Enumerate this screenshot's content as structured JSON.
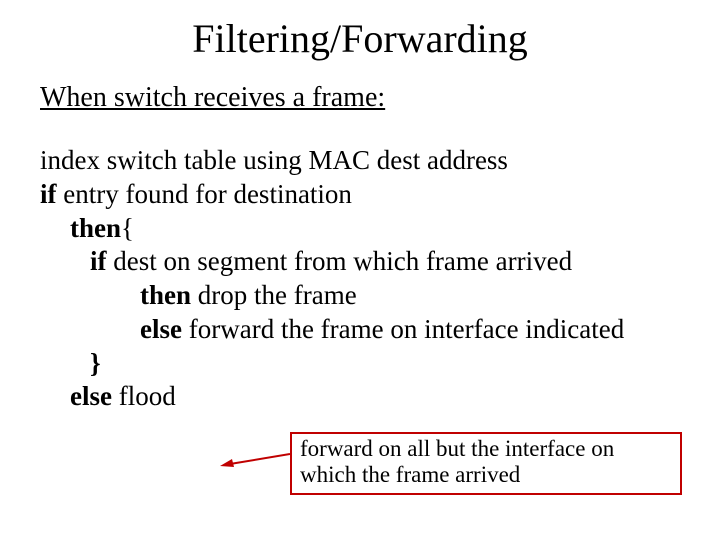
{
  "title": "Filtering/Forwarding",
  "subhead": "When switch receives a frame:",
  "l1": "index switch table using MAC dest address",
  "l2a": "if",
  "l2b": " entry found for destination",
  "l3a": "then",
  "l3b": "{",
  "l4a": "if",
  "l4b": " dest on segment from which frame arrived",
  "l5a": "then",
  "l5b": " drop the frame",
  "l6a": "else",
  "l6b": " forward the frame on interface indicated",
  "l7": "}",
  "l8a": "else",
  "l8b": " flood",
  "callout": "forward on all but the interface on which the frame arrived"
}
